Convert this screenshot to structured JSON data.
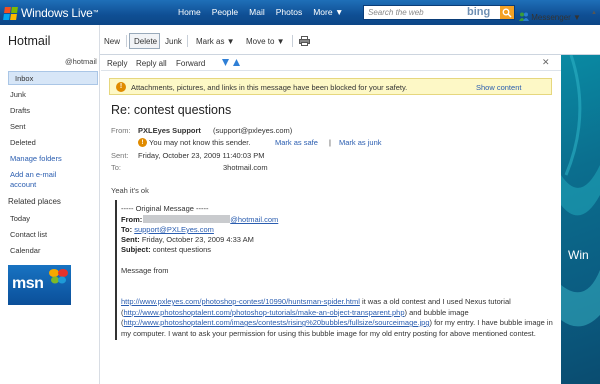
{
  "topbar": {
    "brand": "Windows Live",
    "brand_tm": "™",
    "nav": [
      "Home",
      "People",
      "Mail",
      "Photos",
      "More ▼"
    ],
    "search_placeholder": "Search the web",
    "search_brand": "bing"
  },
  "sidebar": {
    "title": "Hotmail",
    "account": "@hotmail",
    "folders": [
      {
        "label": "Inbox",
        "selected": true
      },
      {
        "label": "Junk"
      },
      {
        "label": "Drafts"
      },
      {
        "label": "Sent"
      },
      {
        "label": "Deleted"
      }
    ],
    "links": [
      "Manage folders",
      "Add an e-mail",
      "account"
    ],
    "related_header": "Related places",
    "related": [
      "Today",
      "Contact list",
      "Calendar"
    ],
    "ad_brand": "msn"
  },
  "toolbar": {
    "new": "New",
    "delete": "Delete",
    "junk": "Junk",
    "mark_as": "Mark as ▼",
    "move_to": "Move to ▼",
    "messenger": "Messenger ▼"
  },
  "message_toolbar": {
    "reply": "Reply",
    "reply_all": "Reply all",
    "forward": "Forward"
  },
  "warning": {
    "text": "Attachments, pictures, and links in this message have been blocked for your safety.",
    "link": "Show content"
  },
  "message": {
    "subject": "Re: contest questions",
    "from_label": "From:",
    "from_name": "PXLEyes Support",
    "from_email": "(support@pxleyes.com)",
    "unknown_sender": "You may not know this sender.",
    "mark_safe": "Mark as safe",
    "separator": "|",
    "mark_junk": "Mark as junk",
    "sent_label": "Sent:",
    "sent_value": "Friday, October 23, 2009 11:40:03 PM",
    "to_label": "To:",
    "to_value": "3hotmail.com",
    "reply_text": "Yeah it's ok"
  },
  "quoted": {
    "header": "----- Original Message -----",
    "from_label": "From:",
    "from_email": "@hotmail.com",
    "to_label": "To:",
    "to_email": "support@PXLEyes.com",
    "sent_label": "Sent:",
    "sent_value": "Friday, October 23, 2009 4:33 AM",
    "subject_label": "Subject:",
    "subject_value": "contest questions",
    "message_from": "Message from",
    "url1": "http://www.pxleyes.com/photoshop-contest/10990/huntsman-spider.html",
    "text1": " it was a old contest and I used Nexus tutorial (",
    "url2": "http://www.photoshoptalent.com/photoshop-tutorials/make-an-object-transparent.php",
    "text2": ") and bubble image (",
    "url3": "http://www.photoshoptalent.com/images/contests/rising%20bubbles/fullsize/sourceimage.jpg",
    "text3": ") for my entry. I have bubble image in my computer. I want to ask your permission for using this bubble image for my old entry posting for above mentioned contest."
  },
  "right_ad": {
    "text": "Win"
  },
  "colors": {
    "topbar": "#1463aa",
    "selected": "#d7e6f7",
    "link": "#2a5db0",
    "warning_bg": "#fdf8c6"
  }
}
